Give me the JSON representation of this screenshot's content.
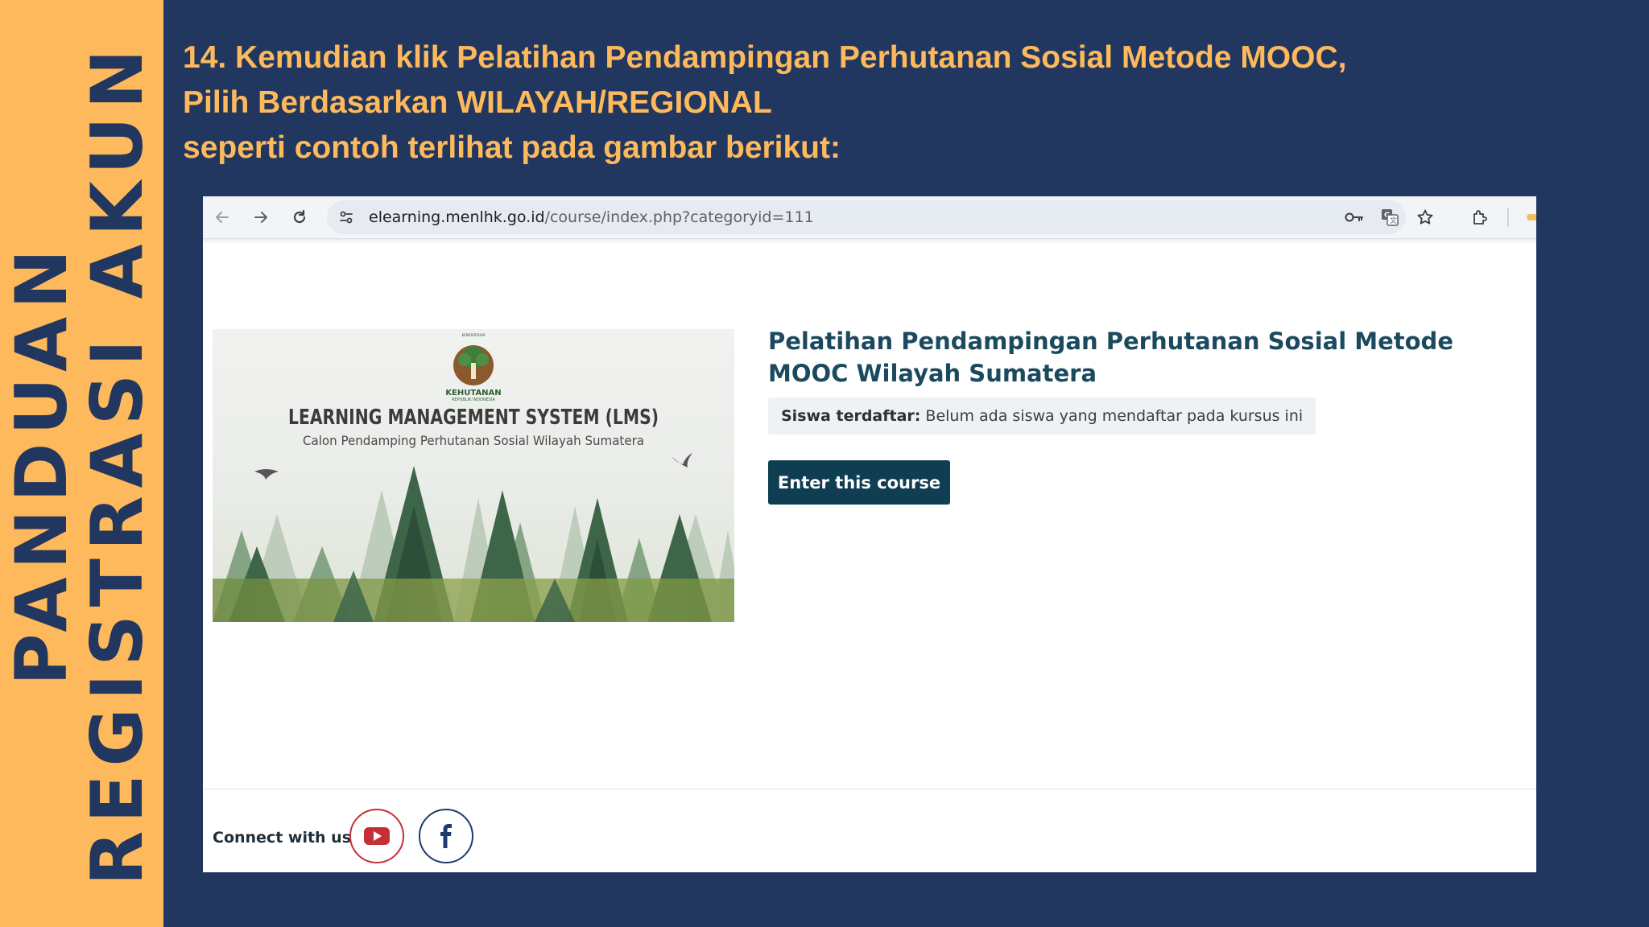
{
  "slide": {
    "side_title_line1": "PANDUAN",
    "side_title_line2": "REGISTRASI AKUN",
    "heading_lines": [
      "14. Kemudian klik Pelatihan Pendampingan Perhutanan Sosial Metode MOOC,",
      "Pilih Berdasarkan WILAYAH/REGIONAL",
      "seperti contoh terlihat pada gambar berikut:"
    ],
    "colors": {
      "background": "#22375f",
      "accent": "#fdb95b"
    }
  },
  "browser": {
    "url_host": "elearning.menlhk.go.id",
    "url_path": "/course/index.php?categoryid=111",
    "icons": {
      "back": "back-arrow-icon",
      "forward": "forward-arrow-icon",
      "reload": "reload-icon",
      "site_info": "site-info-icon",
      "password": "key-icon",
      "translate": "translate-icon",
      "bookmark": "star-icon",
      "extensions": "puzzle-icon"
    }
  },
  "course": {
    "image": {
      "logo_text": "KEHUTANAN",
      "logo_subtext": "REPUBLIK INDONESIA",
      "logo_top_text": "KEMENTERIAN",
      "banner_title": "LEARNING MANAGEMENT SYSTEM (LMS)",
      "banner_subtitle": "Calon Pendamping Perhutanan Sosial Wilayah Sumatera"
    },
    "title": "Pelatihan Pendampingan Perhutanan Sosial Metode MOOC Wilayah Sumatera",
    "enrolled_label": "Siswa terdaftar:",
    "enrolled_value": "Belum ada siswa yang mendaftar pada kursus ini",
    "enter_button": "Enter this course",
    "colors": {
      "title": "#1b4a5e",
      "button": "#0f3d52"
    }
  },
  "footer": {
    "connect_label": "Connect with us:",
    "social": [
      {
        "name": "youtube",
        "icon": "youtube-icon",
        "color": "#c62f36"
      },
      {
        "name": "facebook",
        "icon": "facebook-icon",
        "color": "#1e3a6e"
      }
    ]
  }
}
